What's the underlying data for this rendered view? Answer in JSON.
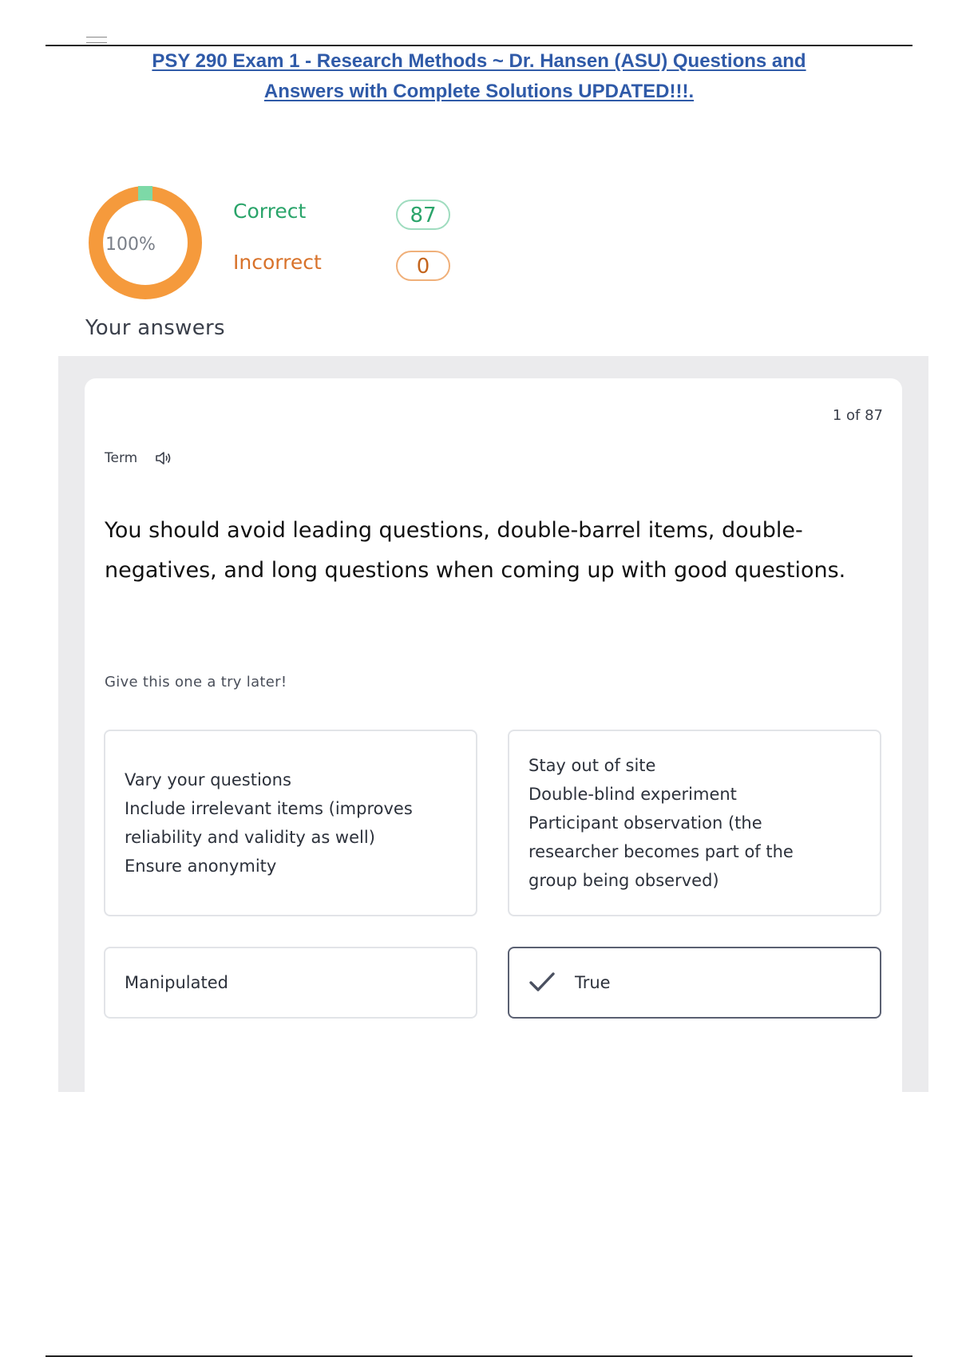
{
  "document": {
    "title_line1": "PSY 290 Exam 1 - Research Methods ~ Dr. Hansen (ASU) Questions and",
    "title_line2": "Answers with Complete Solutions UPDATED!!!."
  },
  "summary": {
    "percent_label": "100%",
    "percent_value": 1.0,
    "correct_label": "Correct",
    "correct_count": "87",
    "incorrect_label": "Incorrect",
    "incorrect_count": "0",
    "ring_color": "#f59a3c",
    "correct_marker_color": "#7dd9a7"
  },
  "your_answers_heading": "Your answers",
  "card": {
    "counter": "1 of 87",
    "term_label": "Term",
    "speaker_icon": "speaker-icon",
    "question": "You should avoid leading questions, double-barrel items, double-negatives, and long questions when coming up with good questions.",
    "hint": "Give this one a try later!",
    "options": [
      {
        "lines": [
          "Vary your questions",
          "Include irrelevant items (improves",
          "reliability and validity as well)",
          "Ensure anonymity"
        ]
      },
      {
        "lines": [
          "Stay out of site",
          "Double-blind experiment",
          "Participant observation (the",
          "researcher becomes part of the",
          "group being observed)"
        ]
      },
      {
        "lines": [
          "Manipulated"
        ]
      },
      {
        "lines": [
          "True"
        ],
        "selected": true,
        "icon": "check-icon"
      }
    ]
  }
}
